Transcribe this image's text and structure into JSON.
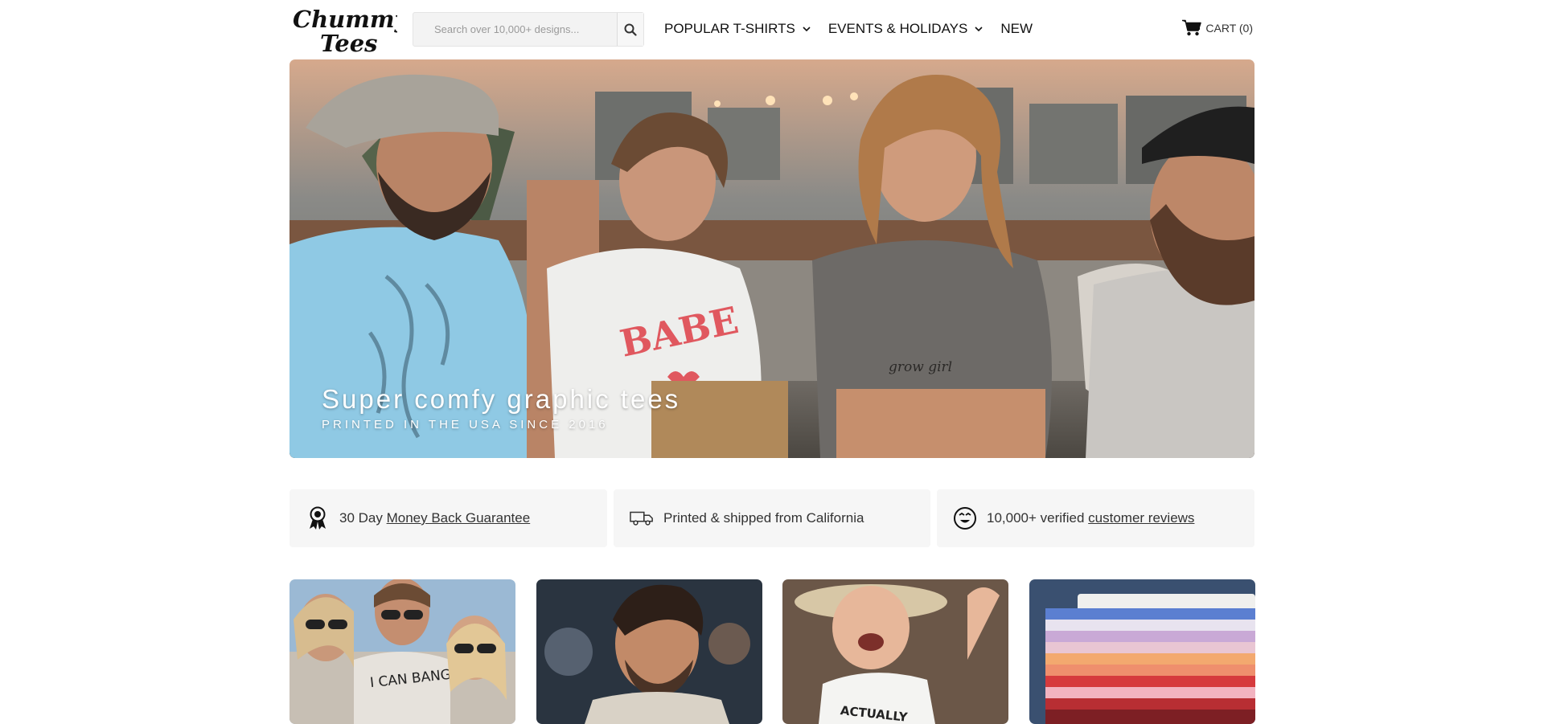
{
  "header": {
    "logo_text_line1": "Chummy",
    "logo_text_line2": "Tees",
    "search_placeholder": "Search over 10,000+ designs...",
    "nav": [
      {
        "label": "POPULAR T-SHIRTS",
        "has_dropdown": true
      },
      {
        "label": "EVENTS & HOLIDAYS",
        "has_dropdown": true
      },
      {
        "label": "NEW",
        "has_dropdown": false
      }
    ],
    "cart_label": "CART (0)"
  },
  "hero": {
    "title": "Super comfy graphic tees",
    "subtitle": "PRINTED IN THE USA SINCE 2016",
    "shirt_text_babe": "BABE",
    "shirt_text_grow": "grow girl"
  },
  "features": [
    {
      "icon": "award-ribbon-icon",
      "text": "30 Day ",
      "link": "Money Back Guarantee"
    },
    {
      "icon": "delivery-truck-icon",
      "text": "Printed & shipped from California",
      "link": ""
    },
    {
      "icon": "happy-face-icon",
      "text": "10,000+ verified ",
      "link": "customer reviews"
    }
  ],
  "cards": [
    {
      "shirt_text": "I CAN BANG"
    },
    {
      "shirt_text": ""
    },
    {
      "shirt_text": "ACTUALLY"
    },
    {
      "shirt_text": ""
    }
  ],
  "colors": {
    "accent": "#111111",
    "feature_bg": "#f6f6f6",
    "shirt_blue": "#8fc9e4",
    "babe_red": "#e0585f"
  }
}
